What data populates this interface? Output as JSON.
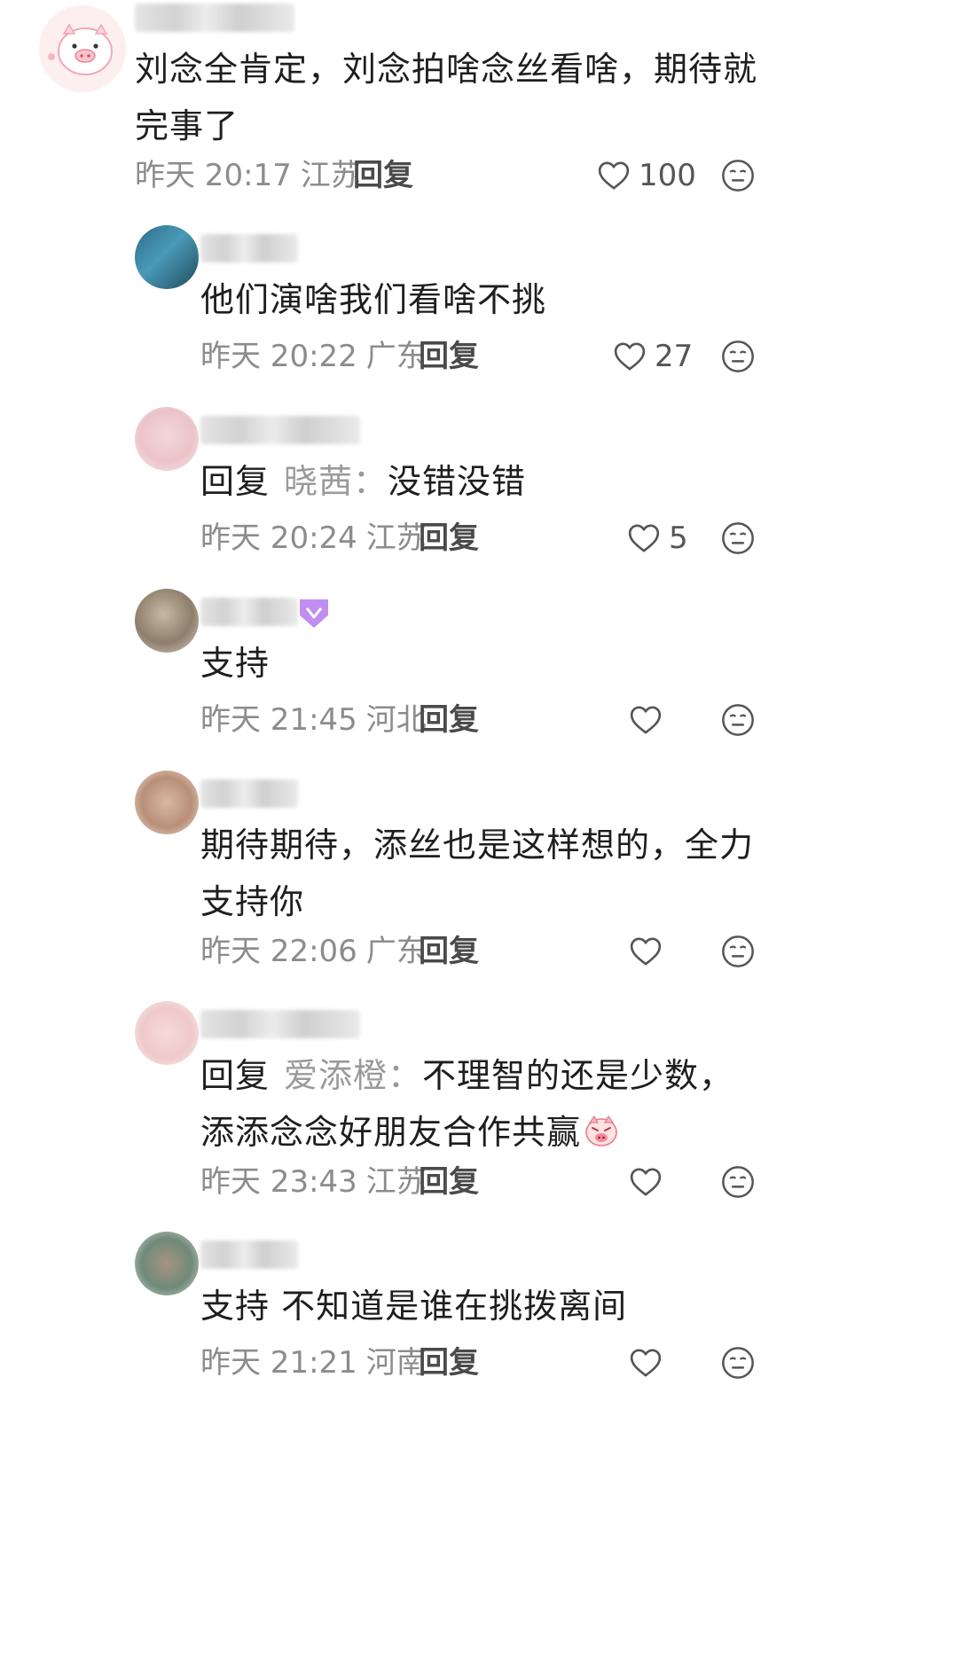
{
  "reply_label": "回复",
  "colors": {
    "text_primary": "#1e1e1e",
    "text_secondary": "#8c8c8c",
    "reply_target": "#9a9a9a",
    "badge_purple": "#b57ae8"
  },
  "icons": {
    "like": "heart-outline-icon",
    "reaction": "neutral-face-icon"
  },
  "comments": [
    {
      "text": "刘念全肯定，刘念拍啥念丝看啥，期待就完事了",
      "time": "昨天 20:17",
      "location": "江苏",
      "likes": "100"
    },
    {
      "text": "他们演啥我们看啥不挑",
      "time": "昨天 20:22",
      "location": "广东",
      "likes": "27"
    },
    {
      "reply_to": "晓茜：",
      "text": "没错没错",
      "time": "昨天 20:24",
      "location": "江苏",
      "likes": "5"
    },
    {
      "text": "支持",
      "time": "昨天 21:45",
      "location": "河北",
      "likes": ""
    },
    {
      "text": "期待期待，添丝也是这样想的，全力支持你",
      "time": "昨天 22:06",
      "location": "广东",
      "likes": ""
    },
    {
      "reply_to": "爱添橙：",
      "text": "不理智的还是少数，添添念念好朋友合作共赢",
      "time": "昨天 23:43",
      "location": "江苏",
      "likes": ""
    },
    {
      "text": "支持 不知道是谁在挑拨离间",
      "time": "昨天 21:21",
      "location": "河南",
      "likes": ""
    }
  ]
}
